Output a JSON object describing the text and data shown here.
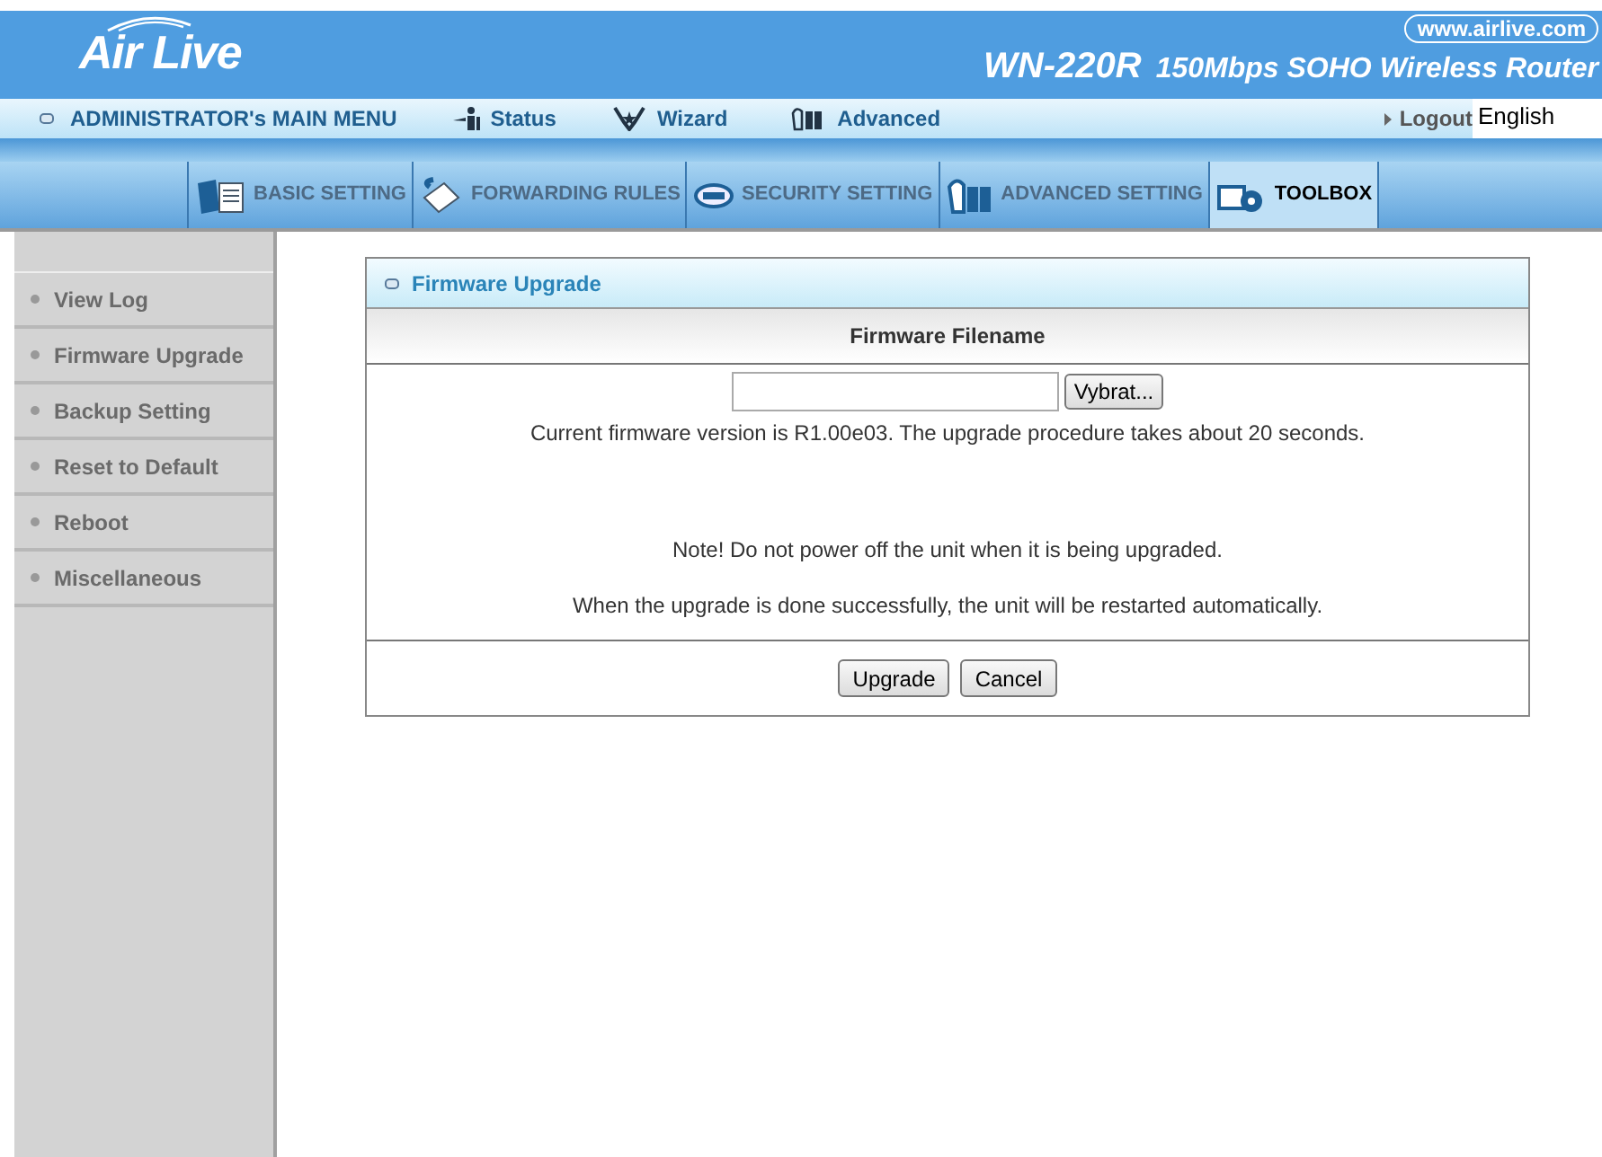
{
  "header": {
    "logo": "Air Live",
    "website": "www.airlive.com",
    "model": "WN-220R",
    "product": "150Mbps SOHO Wireless Router"
  },
  "main_menu": {
    "title": "ADMINISTRATOR's MAIN MENU",
    "items": [
      {
        "label": "Status",
        "kind": "status"
      },
      {
        "label": "Wizard",
        "kind": "wizard"
      },
      {
        "label": "Advanced",
        "kind": "advanced"
      }
    ],
    "logout": "Logout",
    "language": "English"
  },
  "tabs": [
    {
      "label": "BASIC SETTING",
      "kind": "basic",
      "selected": false
    },
    {
      "label": "FORWARDING RULES",
      "kind": "forwarding",
      "selected": false
    },
    {
      "label": "SECURITY SETTING",
      "kind": "security",
      "selected": false
    },
    {
      "label": "ADVANCED SETTING",
      "kind": "advanced",
      "selected": false
    },
    {
      "label": "TOOLBOX",
      "kind": "toolbox",
      "selected": true
    }
  ],
  "sidebar": {
    "items": [
      "View Log",
      "Firmware Upgrade",
      "Backup Setting",
      "Reset to Default",
      "Reboot",
      "Miscellaneous"
    ]
  },
  "panel": {
    "title": "Firmware Upgrade",
    "column": "Firmware Filename",
    "browse_button": "Vybrat...",
    "version_text": "Current firmware version is R1.00e03. The upgrade procedure takes about 20 seconds.",
    "note": "Note! Do not power off the unit when it is being upgraded.",
    "restart_text": "When the upgrade is done successfully, the unit will be restarted automatically.",
    "buttons": [
      "Upgrade",
      "Cancel"
    ]
  }
}
